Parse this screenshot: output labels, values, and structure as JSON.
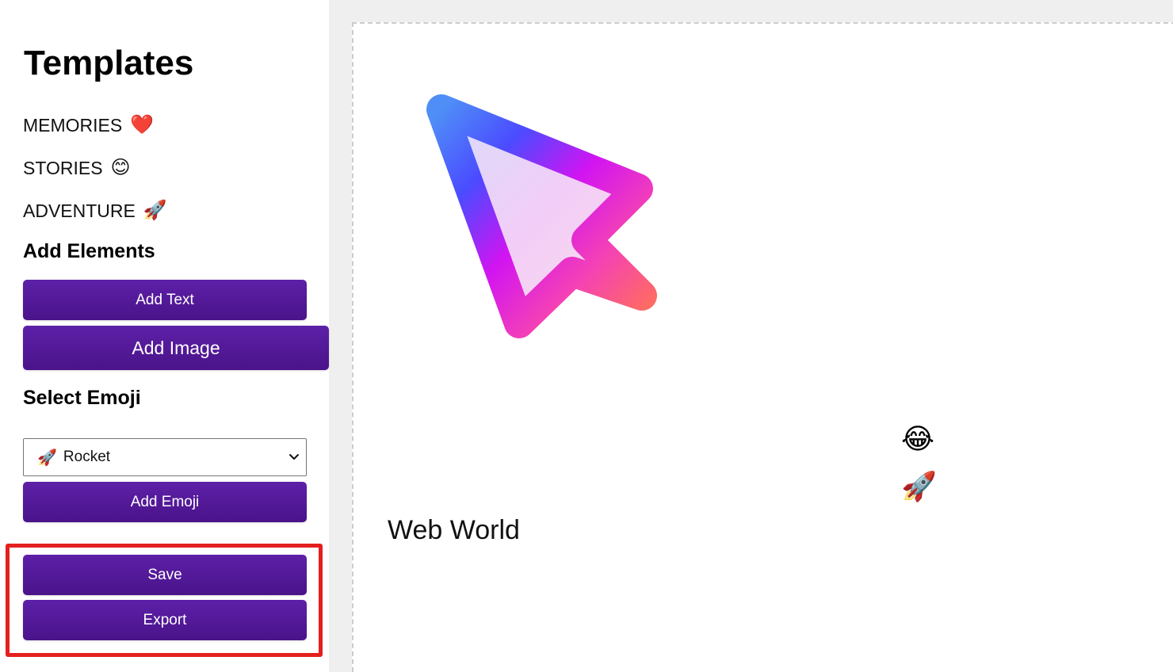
{
  "sidebar": {
    "title": "Templates",
    "templates": [
      {
        "label": "MEMORIES",
        "emoji": "❤️"
      },
      {
        "label": "STORIES",
        "emoji": "😊"
      },
      {
        "label": "ADVENTURE",
        "emoji": "🚀"
      }
    ],
    "add_elements_heading": "Add Elements",
    "add_text_label": "Add Text",
    "add_image_label": "Add Image",
    "select_emoji_heading": "Select Emoji",
    "emoji_select": {
      "selected_emoji": "🚀",
      "selected_label": "Rocket"
    },
    "add_emoji_label": "Add Emoji",
    "save_label": "Save",
    "export_label": "Export"
  },
  "canvas": {
    "emojis": [
      "😂",
      "🚀"
    ],
    "text": "Web World",
    "graphic": "cursor-arrow-icon"
  },
  "colors": {
    "button": "#4f1591",
    "highlight": "#e3201f",
    "arrow_gradient": [
      "#4f8ef7",
      "#4b4bff",
      "#d114f2",
      "#f542b4",
      "#ff6f5a"
    ]
  }
}
